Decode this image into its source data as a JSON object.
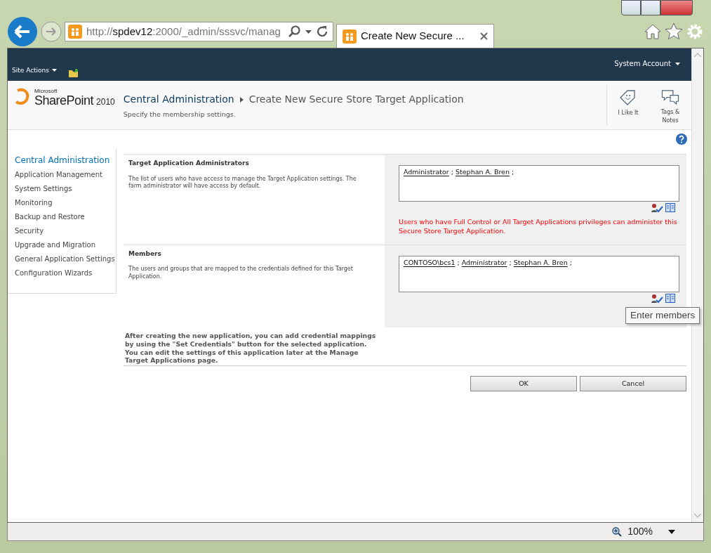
{
  "browser": {
    "address_parts": [
      {
        "text": "http://",
        "highlight": false
      },
      {
        "text": "spdev12",
        "highlight": true
      },
      {
        "text": ":2000/_admin/sssvc/manag",
        "highlight": false
      }
    ],
    "tab_title": "Create New Secure ...",
    "zoom": "100%"
  },
  "top_bar": {
    "site_actions": "Site Actions",
    "user": "System Account"
  },
  "logo": {
    "vendor": "Microsoft",
    "product": "SharePoint",
    "version": "2010"
  },
  "header": {
    "breadcrumb": [
      "Central Administration",
      "Create New Secure Store Target Application"
    ],
    "description": "Specify the membership settings.",
    "actions": [
      {
        "kind": "like",
        "label": "I Like It"
      },
      {
        "kind": "tags",
        "label": "Tags & Notes"
      }
    ]
  },
  "sidebar": {
    "title": "Central Administration",
    "items": [
      "Application Management",
      "System Settings",
      "Monitoring",
      "Backup and Restore",
      "Security",
      "Upgrade and Migration",
      "General Application Settings",
      "Configuration Wizards"
    ]
  },
  "sections": [
    {
      "title": "Target Application Administrators",
      "description": "The list of users who have access to manage the Target Application settings. The farm administrator will have access by default.",
      "people": [
        "Administrator",
        "Stephan A. Bren"
      ],
      "separator": ";",
      "warning": "Users who have Full Control or All Target Applications privileges can administer this Secure Store Target Application."
    },
    {
      "title": "Members",
      "description": "The users and groups that are mapped to the credentials defined for this Target Application.",
      "people": [
        "CONTOSO\\bcs1",
        "Administrator",
        "Stephan A. Bren"
      ],
      "separator": ";",
      "tooltip": "Enter members"
    }
  ],
  "footer_note": "After creating the new application, you can add credential mappings by using the \"Set Credentials\" button for the selected application. You can edit the settings of this application later at the Manage Target Applications page.",
  "buttons": [
    "OK",
    "Cancel"
  ]
}
